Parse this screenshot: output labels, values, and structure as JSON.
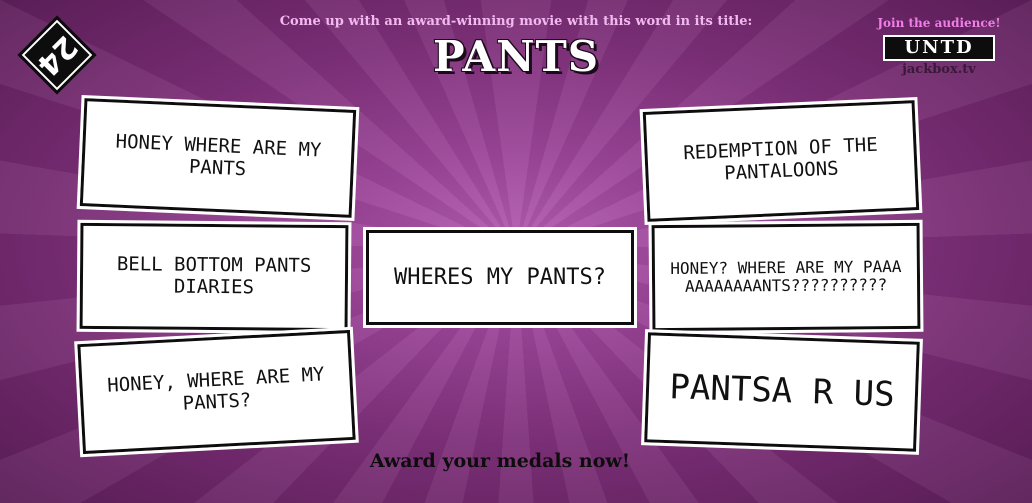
{
  "timer": {
    "value": "24"
  },
  "prompt": {
    "instruction": "Come up with an award-winning movie with this word in its title:",
    "word": "PANTS"
  },
  "audience": {
    "label": "Join the audience!",
    "room_code": "UNTD",
    "site": "jackbox.tv"
  },
  "answers": [
    {
      "text": "HONEY WHERE ARE MY PANTS"
    },
    {
      "text": "BELL BOTTOM PANTS DIARIES"
    },
    {
      "text": "HONEY, WHERE ARE MY PANTS?"
    },
    {
      "text": "WHERES MY PANTS?"
    },
    {
      "text": "REDEMPTION OF THE PANTALOONS"
    },
    {
      "text": "HONEY? WHERE ARE MY PAAAAAAAAAAANTS??????????"
    },
    {
      "text": "PANTSA R US"
    }
  ],
  "footer": {
    "message": "Award your medals now!"
  },
  "colors": {
    "background": "#8a3a86",
    "prompt_text": "#f2b8f0",
    "audience_label": "#ef7fe6",
    "card": "#ffffff",
    "ink": "#0d0d0d"
  }
}
